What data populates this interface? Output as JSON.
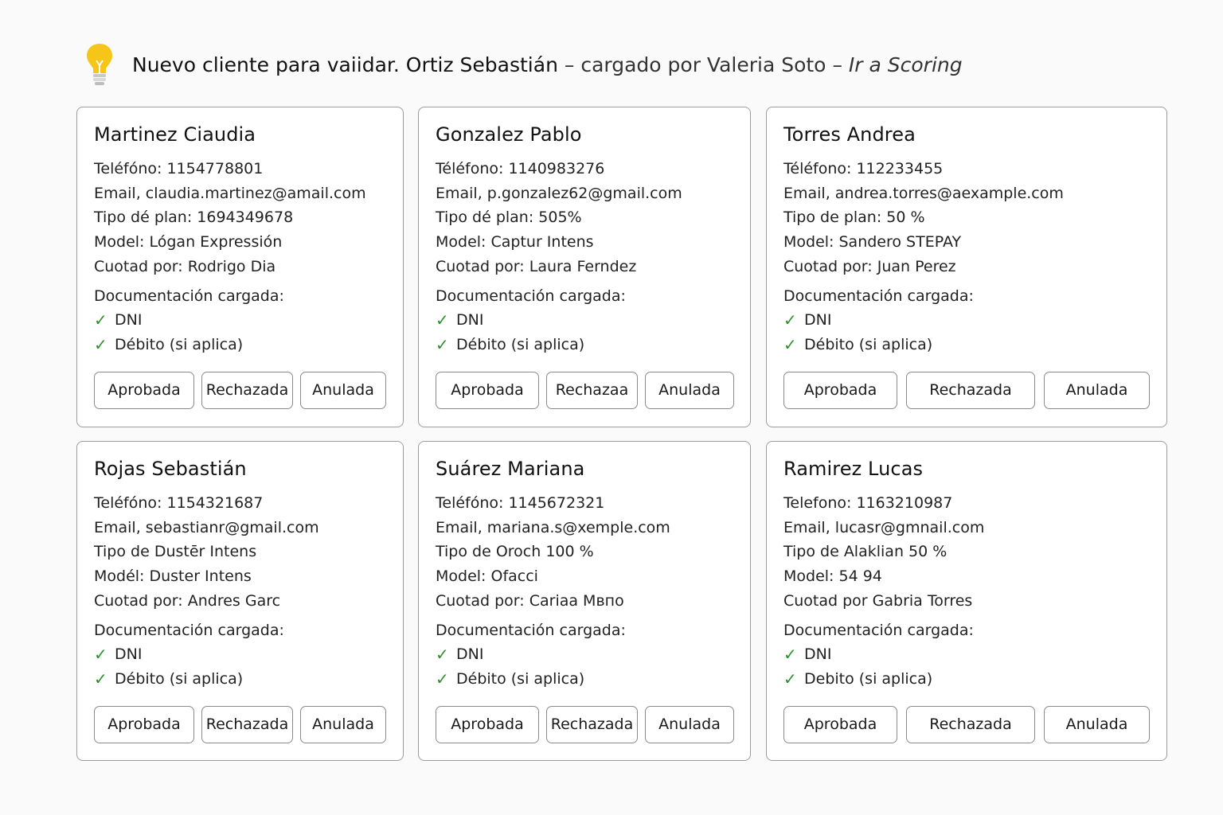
{
  "notice": {
    "icon": "lightbulb-icon",
    "title": "Nuevo cliente para vaiidar. Ortiz Sebastián",
    "separator": "–",
    "loaded_by": "cargado por Valeria Soto",
    "separator2": "–",
    "link": "Ir a Scoring"
  },
  "cards": [
    {
      "name": "Martinez Ciaudia",
      "phone": "Teléfóno:  1154778801",
      "email": "Email,  claudia.martinez@amail.com",
      "plan": "Tipo dé plan:  1694349678",
      "model": "Model:  Lógan Expressión",
      "quoted": "Cuotad por:  Rodrigo Dia",
      "doc_title": "Documentación cargada:",
      "docs": [
        "DNI",
        "Débito (si aplica)"
      ],
      "buttons": [
        "Aprobada",
        "Rechazada",
        "Anulada"
      ]
    },
    {
      "name": "Gonzalez Pablo",
      "phone": "Téléfono:  1140983276",
      "email": "Email,  p.gonzalez62@gmail.com",
      "plan": "Tipo dé plan:  505%",
      "model": "Model:  Captur Intens",
      "quoted": "Cuotad por:  Laura Ferndez",
      "doc_title": "Documentación cargada:",
      "docs": [
        "DNI",
        "Débito (si aplica)"
      ],
      "buttons": [
        "Aprobada",
        "Rechazaa",
        "Anulada"
      ]
    },
    {
      "name": "Torres Andrea",
      "phone": "Téléfono:  112233455",
      "email": "Email,  andrea.torres@aexample.com",
      "plan": "Tipo de plan:  50 %",
      "model": "Model:  Sandero STEPAY",
      "quoted": "Cuotad por:  Juan Perez",
      "doc_title": "Documentación cargada:",
      "docs": [
        "DNI",
        "Débito (si aplica)"
      ],
      "buttons": [
        "Aprobada",
        "Rechazada",
        "Anulada"
      ]
    },
    {
      "name": "Rojas Sebastián",
      "phone": "Teléfóno:  1154321687",
      "email": "Email,  sebastianr@gmail.com",
      "plan": "Tipo de Dustēr Intens",
      "model": "Modél:  Duster Intens",
      "quoted": "Cuotad por:  Andres Garc",
      "doc_title": "Documentación cargada:",
      "docs": [
        "DNI",
        "Débito (si aplica)"
      ],
      "buttons": [
        "Aprobada",
        "Rechazada",
        "Anulada"
      ]
    },
    {
      "name": "Suárez Mariana",
      "phone": "Teléfóno:  1145672321",
      "email": "Email,  mariana.s@xemple.com",
      "plan": "Tipo de Oroch  100 %",
      "model": "Model:  Ofacci",
      "quoted": "Cuotad por:  Cariaa Mвпo",
      "doc_title": "Documentación cargada:",
      "docs": [
        "DNI",
        "Débito (si aplica)"
      ],
      "buttons": [
        "Aprobada",
        "Rechazada",
        "Anulada"
      ]
    },
    {
      "name": "Ramirez Lucas",
      "phone": "Telefono:  1163210987",
      "email": "Email,  lucasr@gmnail.com",
      "plan": "Tipo de Alaklian  50 %",
      "model": "Model:  54   94",
      "quoted": "Cuotad por Gabria Torres",
      "doc_title": "Documentación cargada:",
      "docs": [
        "DNI",
        "Debito (si aplica)"
      ],
      "buttons": [
        "Aprobada",
        "Rechazada",
        "Anulada"
      ]
    }
  ],
  "colors": {
    "check": "#2f8f2f",
    "bulb": "#f5c518",
    "border": "#9c9c9c"
  }
}
